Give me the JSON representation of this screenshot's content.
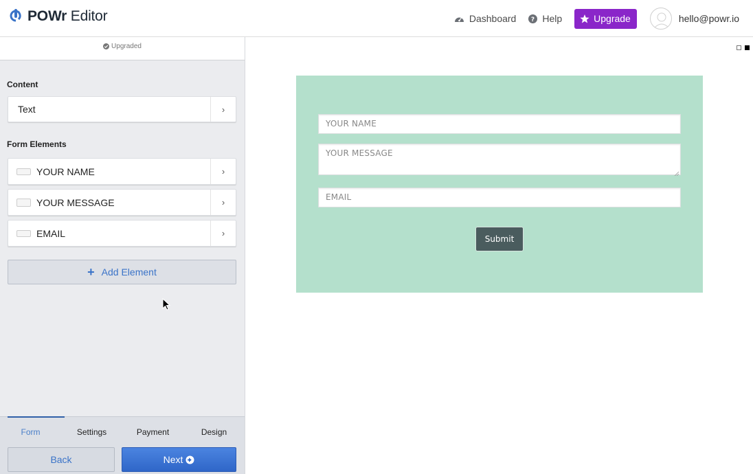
{
  "header": {
    "brand_bold": "POWr",
    "brand_rest": " Editor",
    "nav": {
      "dashboard": "Dashboard",
      "help": "Help",
      "upgrade": "Upgrade"
    },
    "user_email": "hello@powr.io",
    "colors": {
      "upgrade_bg": "#8a26c9",
      "logo": "#3a73c8"
    }
  },
  "sidebar": {
    "status": "Upgraded",
    "content_title": "Content",
    "content_items": [
      {
        "label": "Text"
      }
    ],
    "form_elements_title": "Form Elements",
    "form_elements": [
      {
        "label": "YOUR NAME",
        "icon": "single-line-field-icon"
      },
      {
        "label": "YOUR MESSAGE",
        "icon": "multi-line-field-icon"
      },
      {
        "label": "EMAIL",
        "icon": "email-field-icon"
      }
    ],
    "add_element": "Add Element",
    "tabs": [
      {
        "label": "Form",
        "active": true
      },
      {
        "label": "Settings",
        "active": false
      },
      {
        "label": "Payment",
        "active": false
      },
      {
        "label": "Design",
        "active": false
      }
    ],
    "back": "Back",
    "next": "Next"
  },
  "preview": {
    "panel_color": "#b4e0cc",
    "fields": {
      "name_placeholder": "YOUR NAME",
      "message_placeholder": "YOUR MESSAGE",
      "email_placeholder": "EMAIL"
    },
    "submit": "Submit"
  }
}
